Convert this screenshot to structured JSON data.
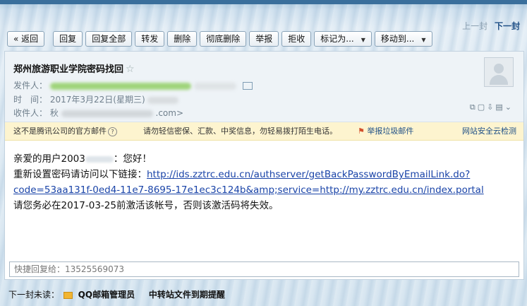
{
  "nav": {
    "prev": "上一封",
    "next": "下一封"
  },
  "toolbar": {
    "back": "« 返回",
    "reply": "回复",
    "reply_all": "回复全部",
    "forward": "转发",
    "delete": "删除",
    "delete_permanent": "彻底删除",
    "report": "举报",
    "reject": "拒收",
    "mark_as": "标记为...",
    "move_to": "移动到..."
  },
  "mail": {
    "subject": "郑州旅游职业学院密码找回",
    "from_label": "发件人：",
    "time_label": "时　间：",
    "time_value": "2017年3月22日(星期三)",
    "to_label": "收件人：",
    "to_prefix": "秋",
    "to_suffix": ".com>",
    "notice_official": "这不是腾讯公司的官方邮件",
    "notice_warning": "请勿轻信密保、汇款、中奖信息，勿轻易拨打陌生电话。",
    "notice_report": "举报垃圾邮件",
    "notice_security": "网站安全云检测",
    "body": {
      "greeting_prefix": "亲爱的用户2003",
      "greeting_suffix": "：您好！",
      "link_intro": "重新设置密码请访问以下链接：",
      "link_line1": "http://ids.zztrc.edu.cn/authserver/getBackPasswordByEmailLink.do?",
      "link_line2": "code=53aa131f-0ed4-11e7-8695-17e1ec3c124b&amp;service=http://my.zztrc.edu.cn/index.portal",
      "expire_note": "请您务必在2017-03-25前激活该帐号，否则该激活码将失效。"
    },
    "quick_reply_placeholder": "快捷回复给：13525569073"
  },
  "footer": {
    "next_unread_label": "下一封未读：",
    "sender": "QQ邮箱管理员",
    "next_subject": "中转站文件到期提醒"
  },
  "colors": {
    "link": "#1a44a8",
    "notice_bg": "#fdf4cf",
    "nav_next": "#1e4f86"
  }
}
